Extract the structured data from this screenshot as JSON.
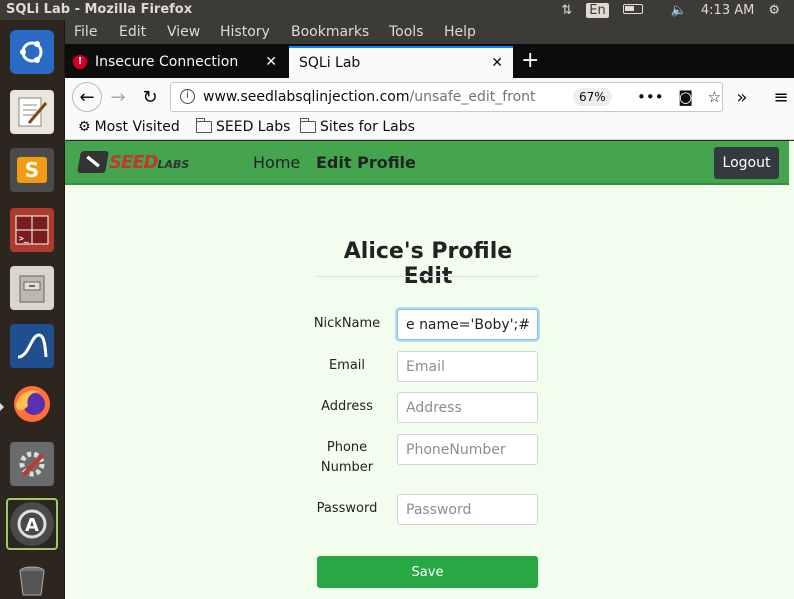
{
  "window": {
    "title": "SQLi Lab - Mozilla Firefox"
  },
  "system_tray": {
    "keyboard": "En",
    "time": "4:13 AM"
  },
  "menubar": [
    "File",
    "Edit",
    "View",
    "History",
    "Bookmarks",
    "Tools",
    "Help"
  ],
  "tabs": [
    {
      "label": "Insecure Connection",
      "active": false
    },
    {
      "label": "SQLi Lab",
      "active": true
    }
  ],
  "urlbar": {
    "host": "www.seedlabsqlinjection.com",
    "path": "/unsafe_edit_front",
    "zoom": "67%"
  },
  "bookmarks": [
    "Most Visited",
    "SEED Labs",
    "Sites for Labs"
  ],
  "site": {
    "logo_main": "SEED",
    "logo_sub": "LABS",
    "nav_home": "Home",
    "nav_edit": "Edit Profile",
    "logout": "Logout"
  },
  "form": {
    "title": "Alice's Profile Edit",
    "fields": [
      {
        "label": "NickName",
        "value": "e name='Boby';#",
        "placeholder": ""
      },
      {
        "label": "Email",
        "value": "",
        "placeholder": "Email"
      },
      {
        "label": "Address",
        "value": "",
        "placeholder": "Address"
      },
      {
        "label_line1": "Phone",
        "label_line2": "Number",
        "value": "",
        "placeholder": "PhoneNumber"
      },
      {
        "label": "Password",
        "value": "",
        "placeholder": "Password"
      }
    ],
    "save_label": "Save"
  },
  "colors": {
    "nav_green": "#45a54f",
    "page_bg": "#f3fdee",
    "save_green": "#28a745",
    "logout_dark": "#343a40"
  }
}
